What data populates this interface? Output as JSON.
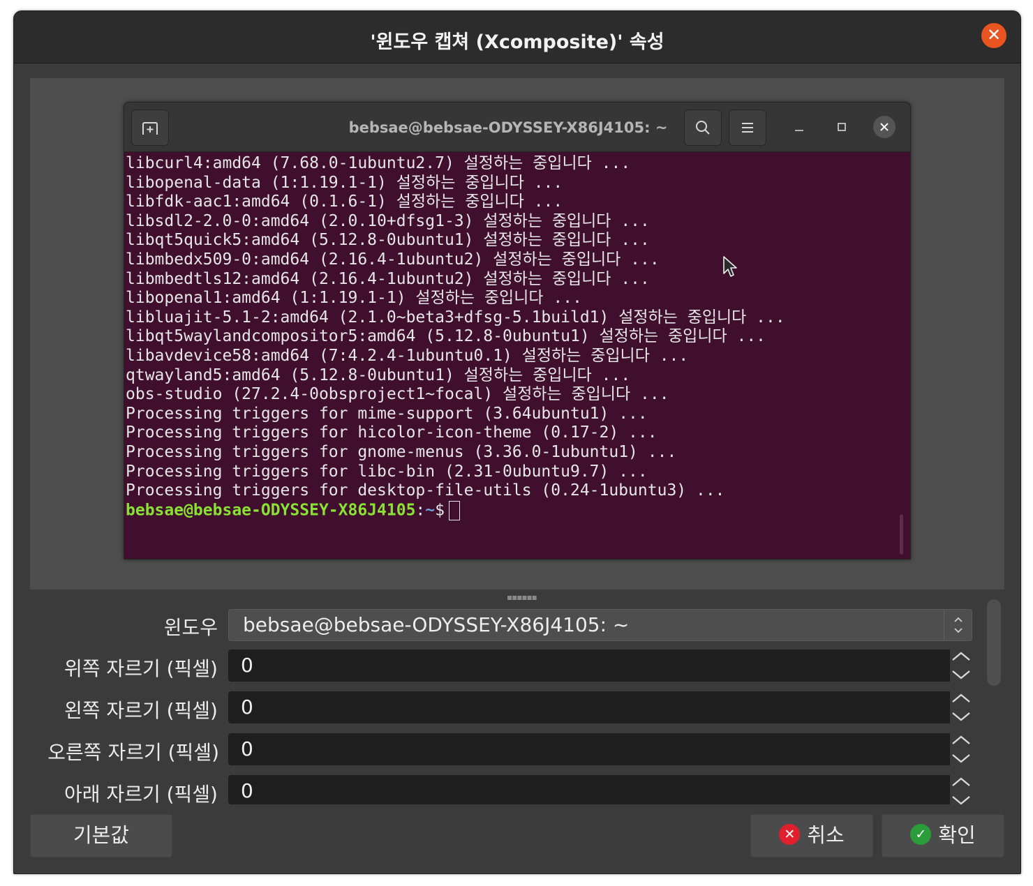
{
  "dialog": {
    "title": "'윈도우 캡쳐 (Xcomposite)' 속성",
    "close_glyph": "✕"
  },
  "terminal": {
    "title": "bebsae@bebsae-ODYSSEY-X86J4105: ~",
    "lines": [
      "libcurl4:amd64 (7.68.0-1ubuntu2.7) 설정하는 중입니다 ...",
      "libopenal-data (1:1.19.1-1) 설정하는 중입니다 ...",
      "libfdk-aac1:amd64 (0.1.6-1) 설정하는 중입니다 ...",
      "libsdl2-2.0-0:amd64 (2.0.10+dfsg1-3) 설정하는 중입니다 ...",
      "libqt5quick5:amd64 (5.12.8-0ubuntu1) 설정하는 중입니다 ...",
      "libmbedx509-0:amd64 (2.16.4-1ubuntu2) 설정하는 중입니다 ...",
      "libmbedtls12:amd64 (2.16.4-1ubuntu2) 설정하는 중입니다 ...",
      "libopenal1:amd64 (1:1.19.1-1) 설정하는 중입니다 ...",
      "libluajit-5.1-2:amd64 (2.1.0~beta3+dfsg-5.1build1) 설정하는 중입니다 ...",
      "libqt5waylandcompositor5:amd64 (5.12.8-0ubuntu1) 설정하는 중입니다 ...",
      "libavdevice58:amd64 (7:4.2.4-1ubuntu0.1) 설정하는 중입니다 ...",
      "qtwayland5:amd64 (5.12.8-0ubuntu1) 설정하는 중입니다 ...",
      "obs-studio (27.2.4-0obsproject1~focal) 설정하는 중입니다 ...",
      "Processing triggers for mime-support (3.64ubuntu1) ...",
      "Processing triggers for hicolor-icon-theme (0.17-2) ...",
      "Processing triggers for gnome-menus (3.36.0-1ubuntu1) ...",
      "Processing triggers for libc-bin (2.31-0ubuntu9.7) ...",
      "Processing triggers for desktop-file-utils (0.24-1ubuntu3) ..."
    ],
    "prompt_user": "bebsae@bebsae-ODYSSEY-X86J4105",
    "prompt_sep": ":",
    "prompt_path": "~",
    "prompt_symbol": "$"
  },
  "properties": {
    "window_label": "윈도우",
    "window_value": "bebsae@bebsae-ODYSSEY-X86J4105: ~",
    "crop_top_label": "위쪽 자르기 (픽셀)",
    "crop_top_value": "0",
    "crop_left_label": "왼쪽 자르기 (픽셀)",
    "crop_left_value": "0",
    "crop_right_label": "오른쪽 자르기 (픽셀)",
    "crop_right_value": "0",
    "crop_bottom_label": "아래 자르기 (픽셀)",
    "crop_bottom_value": "0"
  },
  "buttons": {
    "defaults": "기본값",
    "cancel": "취소",
    "ok": "확인"
  },
  "colors": {
    "accent_close": "#e95420",
    "terminal_bg": "#3f0f2d",
    "prompt_user": "#8ae234",
    "prompt_path": "#729fcf",
    "cancel_icon": "#e0202f",
    "ok_icon": "#2a9d3a"
  }
}
